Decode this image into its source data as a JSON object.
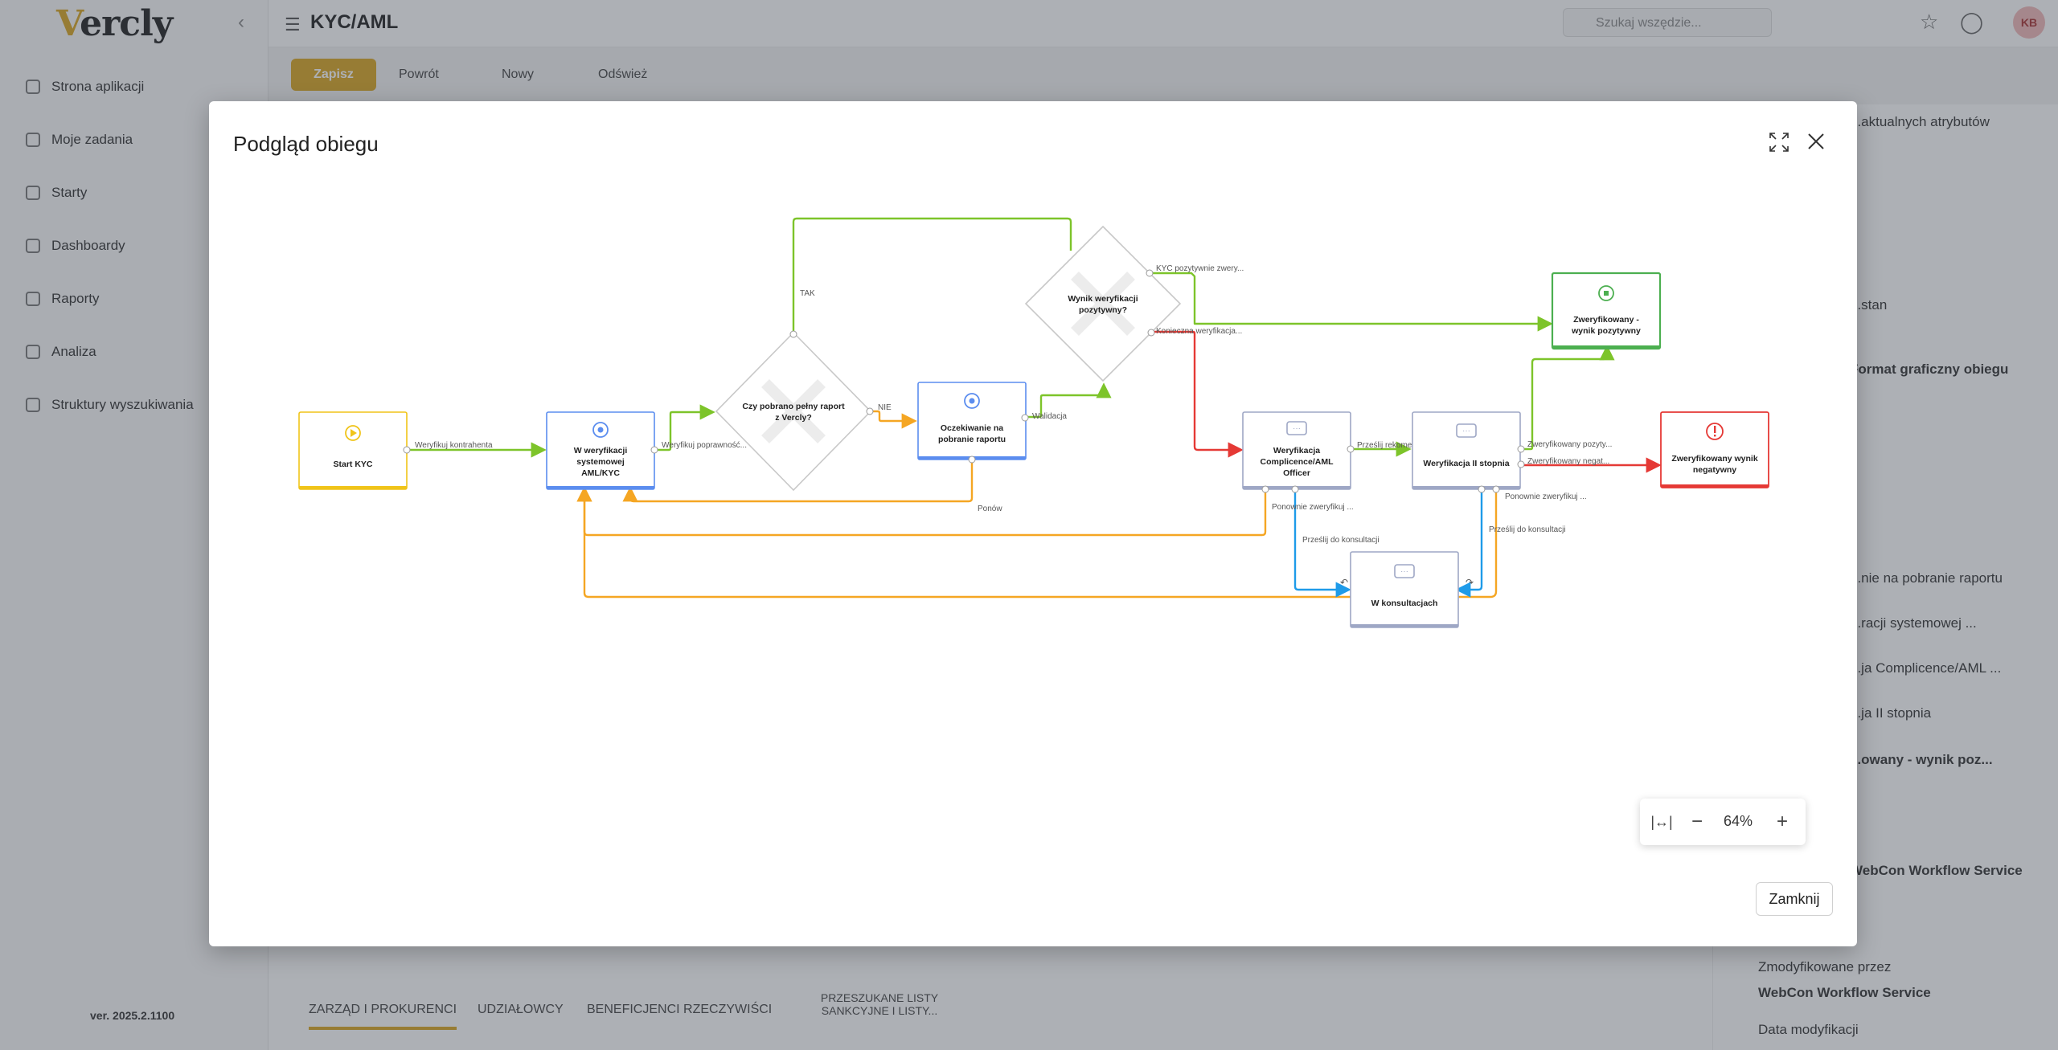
{
  "app": {
    "logo": "Vercly",
    "page_title": "KYC/AML",
    "version": "ver. 2025.2.1100",
    "search_placeholder": "Szukaj wszędzie...",
    "user_initials": "KB",
    "nav": [
      {
        "label": "Strona aplikacji"
      },
      {
        "label": "Moje zadania"
      },
      {
        "label": "Starty"
      },
      {
        "label": "Dashboardy"
      },
      {
        "label": "Raporty"
      },
      {
        "label": "Analiza"
      },
      {
        "label": "Struktury wyszukiwania"
      }
    ],
    "toolbar": {
      "save": "Zapisz",
      "action2": "Powrót",
      "new": "Nowy",
      "refresh": "Odśwież"
    },
    "bottom_tabs": [
      "Zarząd i prokurenci",
      "Udziałowcy",
      "Beneficjenci rzeczywiści",
      "Przeszukane listy sankcyjne i listy..."
    ],
    "right_panel": [
      "...aktualnych atrybutów",
      "...stan",
      "Format graficzny obiegu",
      "...nie na pobranie raportu",
      "...racji systemowej ...",
      "...ja Complicence/AML ...",
      "...ja II stopnia",
      "...owany - wynik poz...",
      "WebCon Workflow Service",
      "Zmodyfikowane przez",
      "WebCon Workflow Service",
      "Data modyfikacji"
    ]
  },
  "modal": {
    "title": "Podgląd obiegu",
    "zoom": "64%",
    "close_label": "Zamknij"
  },
  "workflow": {
    "nodes": [
      {
        "id": "start",
        "label": [
          "Start KYC"
        ],
        "kind": "start",
        "color": "#f0c419"
      },
      {
        "id": "verif",
        "label": [
          "W weryfikacji",
          "systemowej",
          "AML/KYC"
        ],
        "kind": "system",
        "color": "#5b8def"
      },
      {
        "id": "dec1",
        "label": [
          "Czy pobrano pełny raport",
          "z Vercly?"
        ],
        "kind": "decision",
        "color": "#cccccc"
      },
      {
        "id": "wait",
        "label": [
          "Oczekiwanie na",
          "pobranie raportu"
        ],
        "kind": "system",
        "color": "#5b8def"
      },
      {
        "id": "dec2",
        "label": [
          "Wynik weryfikacji",
          "pozytywny?"
        ],
        "kind": "decision",
        "color": "#cccccc"
      },
      {
        "id": "pos",
        "label": [
          "Zweryfikowany -",
          "wynik pozytywny"
        ],
        "kind": "end-positive",
        "color": "#4caf50"
      },
      {
        "id": "aml",
        "label": [
          "Weryfikacja",
          "Complicence/AML",
          "Officer"
        ],
        "kind": "task",
        "color": "#9ea7c5"
      },
      {
        "id": "lvl2",
        "label": [
          "Weryfikacja II stopnia"
        ],
        "kind": "task",
        "color": "#9ea7c5"
      },
      {
        "id": "neg",
        "label": [
          "Zweryfikowany wynik",
          "negatywny"
        ],
        "kind": "end-negative",
        "color": "#e53935"
      },
      {
        "id": "cons",
        "label": [
          "W konsultacjach"
        ],
        "kind": "task",
        "color": "#9ea7c5"
      }
    ],
    "edges": [
      {
        "label": "Weryfikuj kontrahenta",
        "color": "#7dc42a"
      },
      {
        "label": "Weryfikuj poprawność...",
        "color": "#7dc42a"
      },
      {
        "label": "TAK",
        "color": "#7dc42a"
      },
      {
        "label": "NIE",
        "color": "#f5a623"
      },
      {
        "label": "Walidacja",
        "color": "#7dc42a"
      },
      {
        "label": "KYC pozytywnie zwery...",
        "color": "#7dc42a"
      },
      {
        "label": "Konieczna weryfikacja...",
        "color": "#e53935"
      },
      {
        "label": "Ponów",
        "color": "#f5a623"
      },
      {
        "label": "Prześlij rekomen...",
        "color": "#7dc42a"
      },
      {
        "label": "Zweryfikowany pozyty...",
        "color": "#7dc42a"
      },
      {
        "label": "Zweryfikowany negat...",
        "color": "#e53935"
      },
      {
        "label": "Ponownie zweryfikuj ...",
        "color": "#f5a623"
      },
      {
        "label": "Ponownie zweryfikuj ...",
        "color": "#f5a623"
      },
      {
        "label": "Prześlij do konsultacji",
        "color": "#1e9be9"
      },
      {
        "label": "Prześlij do konsultacji",
        "color": "#1e9be9"
      }
    ]
  }
}
